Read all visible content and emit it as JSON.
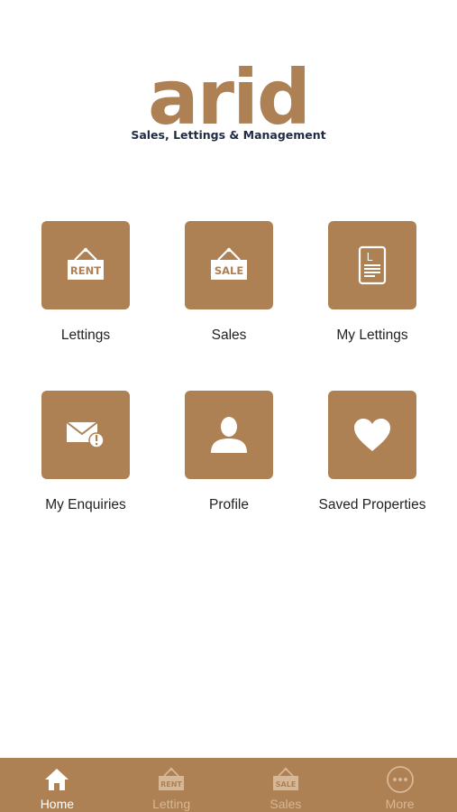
{
  "app": {
    "logo_word": "arid",
    "tagline": "Sales, Lettings & Management"
  },
  "tiles": [
    {
      "label": "Lettings",
      "icon": "rent-sign-icon",
      "sign_text": "RENT"
    },
    {
      "label": "Sales",
      "icon": "sale-sign-icon",
      "sign_text": "SALE"
    },
    {
      "label": "My Lettings",
      "icon": "document-l-icon",
      "doc_letter": "L"
    },
    {
      "label": "My Enquiries",
      "icon": "envelope-alert-icon"
    },
    {
      "label": "Profile",
      "icon": "person-icon"
    },
    {
      "label": "Saved Properties",
      "icon": "heart-icon"
    }
  ],
  "bottom_nav": {
    "active": "Home",
    "items": [
      {
        "label": "Home",
        "icon": "home-icon"
      },
      {
        "label": "Letting",
        "icon": "rent-sign-icon",
        "sign_text": "RENT"
      },
      {
        "label": "Sales",
        "icon": "sale-sign-icon",
        "sign_text": "SALE"
      },
      {
        "label": "More",
        "icon": "more-dots-icon"
      }
    ]
  },
  "colors": {
    "brand": "#ae8155",
    "tagline": "#1f2a44",
    "nav_inactive": "#d6b796",
    "nav_active": "#ffffff"
  }
}
